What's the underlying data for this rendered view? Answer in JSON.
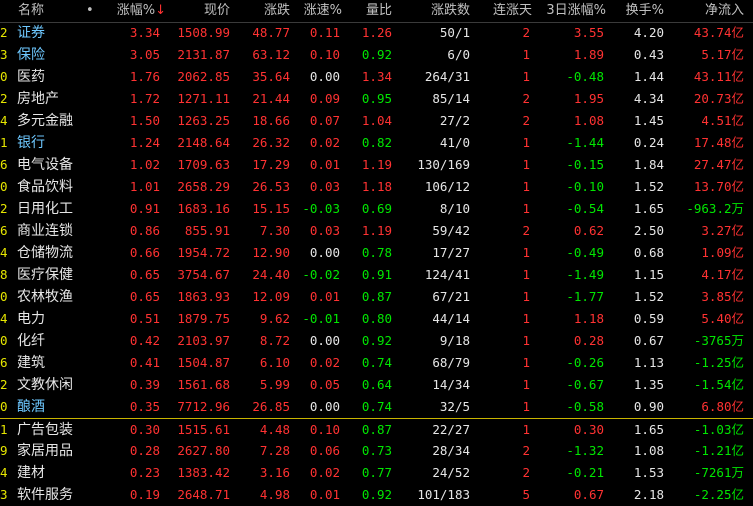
{
  "header": {
    "name": "名称",
    "dot": "•",
    "change_pct": "涨幅%",
    "sort_arrow": "↓",
    "price": "现价",
    "change": "涨跌",
    "speed": "涨速%",
    "volume_ratio": "量比",
    "up_down_count": "涨跌数",
    "consecutive_up_days": "连涨天",
    "three_day_change": "3日涨幅%",
    "turnover": "换手%",
    "net_inflow": "净流入"
  },
  "rows": [
    {
      "idx": "2",
      "name": "证券",
      "highlight": true,
      "chg": "3.34",
      "price": "1508.99",
      "diff": "48.77",
      "speed": "0.11",
      "speed_dir": "up",
      "ratio": "1.26",
      "ratio_dir": "up",
      "ud": "50/1",
      "days": "2",
      "days_dir": "up",
      "chg3": "3.55",
      "chg3_dir": "up",
      "turn": "4.20",
      "flow": "43.74亿",
      "flow_dir": "up"
    },
    {
      "idx": "3",
      "name": "保险",
      "highlight": true,
      "chg": "3.05",
      "price": "2131.87",
      "diff": "63.12",
      "speed": "0.10",
      "speed_dir": "up",
      "ratio": "0.92",
      "ratio_dir": "down",
      "ud": "6/0",
      "days": "1",
      "days_dir": "up",
      "chg3": "1.89",
      "chg3_dir": "up",
      "turn": "0.43",
      "flow": "5.17亿",
      "flow_dir": "up"
    },
    {
      "idx": "0",
      "name": "医药",
      "highlight": false,
      "chg": "1.76",
      "price": "2062.85",
      "diff": "35.64",
      "speed": "0.00",
      "speed_dir": "flat",
      "ratio": "1.34",
      "ratio_dir": "up",
      "ud": "264/31",
      "days": "1",
      "days_dir": "up",
      "chg3": "-0.48",
      "chg3_dir": "down",
      "turn": "1.44",
      "flow": "43.11亿",
      "flow_dir": "up"
    },
    {
      "idx": "2",
      "name": "房地产",
      "highlight": false,
      "chg": "1.72",
      "price": "1271.11",
      "diff": "21.44",
      "speed": "0.09",
      "speed_dir": "up",
      "ratio": "0.95",
      "ratio_dir": "down",
      "ud": "85/14",
      "days": "2",
      "days_dir": "up",
      "chg3": "1.95",
      "chg3_dir": "up",
      "turn": "4.34",
      "flow": "20.73亿",
      "flow_dir": "up"
    },
    {
      "idx": "4",
      "name": "多元金融",
      "highlight": false,
      "chg": "1.50",
      "price": "1263.25",
      "diff": "18.66",
      "speed": "0.07",
      "speed_dir": "up",
      "ratio": "1.04",
      "ratio_dir": "up",
      "ud": "27/2",
      "days": "2",
      "days_dir": "up",
      "chg3": "1.08",
      "chg3_dir": "up",
      "turn": "1.45",
      "flow": "4.51亿",
      "flow_dir": "up"
    },
    {
      "idx": "1",
      "name": "银行",
      "highlight": true,
      "chg": "1.24",
      "price": "2148.64",
      "diff": "26.32",
      "speed": "0.02",
      "speed_dir": "up",
      "ratio": "0.82",
      "ratio_dir": "down",
      "ud": "41/0",
      "days": "1",
      "days_dir": "up",
      "chg3": "-1.44",
      "chg3_dir": "down",
      "turn": "0.24",
      "flow": "17.48亿",
      "flow_dir": "up"
    },
    {
      "idx": "6",
      "name": "电气设备",
      "highlight": false,
      "chg": "1.02",
      "price": "1709.63",
      "diff": "17.29",
      "speed": "0.01",
      "speed_dir": "up",
      "ratio": "1.19",
      "ratio_dir": "up",
      "ud": "130/169",
      "days": "1",
      "days_dir": "up",
      "chg3": "-0.15",
      "chg3_dir": "down",
      "turn": "1.84",
      "flow": "27.47亿",
      "flow_dir": "up"
    },
    {
      "idx": "0",
      "name": "食品饮料",
      "highlight": false,
      "chg": "1.01",
      "price": "2658.29",
      "diff": "26.53",
      "speed": "0.03",
      "speed_dir": "up",
      "ratio": "1.18",
      "ratio_dir": "up",
      "ud": "106/12",
      "days": "1",
      "days_dir": "up",
      "chg3": "-0.10",
      "chg3_dir": "down",
      "turn": "1.52",
      "flow": "13.70亿",
      "flow_dir": "up"
    },
    {
      "idx": "2",
      "name": "日用化工",
      "highlight": false,
      "chg": "0.91",
      "price": "1683.16",
      "diff": "15.15",
      "speed": "-0.03",
      "speed_dir": "down",
      "ratio": "0.69",
      "ratio_dir": "down",
      "ud": "8/10",
      "days": "1",
      "days_dir": "up",
      "chg3": "-0.54",
      "chg3_dir": "down",
      "turn": "1.65",
      "flow": "-963.2万",
      "flow_dir": "down"
    },
    {
      "idx": "6",
      "name": "商业连锁",
      "highlight": false,
      "chg": "0.86",
      "price": "855.91",
      "diff": "7.30",
      "speed": "0.03",
      "speed_dir": "up",
      "ratio": "1.19",
      "ratio_dir": "up",
      "ud": "59/42",
      "days": "2",
      "days_dir": "up",
      "chg3": "0.62",
      "chg3_dir": "up",
      "turn": "2.50",
      "flow": "3.27亿",
      "flow_dir": "up"
    },
    {
      "idx": "4",
      "name": "仓储物流",
      "highlight": false,
      "chg": "0.66",
      "price": "1954.72",
      "diff": "12.90",
      "speed": "0.00",
      "speed_dir": "flat",
      "ratio": "0.78",
      "ratio_dir": "down",
      "ud": "17/27",
      "days": "1",
      "days_dir": "up",
      "chg3": "-0.49",
      "chg3_dir": "down",
      "turn": "0.68",
      "flow": "1.09亿",
      "flow_dir": "up"
    },
    {
      "idx": "8",
      "name": "医疗保健",
      "highlight": false,
      "chg": "0.65",
      "price": "3754.67",
      "diff": "24.40",
      "speed": "-0.02",
      "speed_dir": "down",
      "ratio": "0.91",
      "ratio_dir": "down",
      "ud": "124/41",
      "days": "1",
      "days_dir": "up",
      "chg3": "-1.49",
      "chg3_dir": "down",
      "turn": "1.15",
      "flow": "4.17亿",
      "flow_dir": "up"
    },
    {
      "idx": "0",
      "name": "农林牧渔",
      "highlight": false,
      "chg": "0.65",
      "price": "1863.93",
      "diff": "12.09",
      "speed": "0.01",
      "speed_dir": "up",
      "ratio": "0.87",
      "ratio_dir": "down",
      "ud": "67/21",
      "days": "1",
      "days_dir": "up",
      "chg3": "-1.77",
      "chg3_dir": "down",
      "turn": "1.52",
      "flow": "3.85亿",
      "flow_dir": "up"
    },
    {
      "idx": "4",
      "name": "电力",
      "highlight": false,
      "chg": "0.51",
      "price": "1879.75",
      "diff": "9.62",
      "speed": "-0.01",
      "speed_dir": "down",
      "ratio": "0.80",
      "ratio_dir": "down",
      "ud": "44/14",
      "days": "1",
      "days_dir": "up",
      "chg3": "1.18",
      "chg3_dir": "up",
      "turn": "0.59",
      "flow": "5.40亿",
      "flow_dir": "up"
    },
    {
      "idx": "0",
      "name": "化纤",
      "highlight": false,
      "chg": "0.42",
      "price": "2103.97",
      "diff": "8.72",
      "speed": "0.00",
      "speed_dir": "flat",
      "ratio": "0.92",
      "ratio_dir": "down",
      "ud": "9/18",
      "days": "1",
      "days_dir": "up",
      "chg3": "0.28",
      "chg3_dir": "up",
      "turn": "0.67",
      "flow": "-3765万",
      "flow_dir": "down"
    },
    {
      "idx": "6",
      "name": "建筑",
      "highlight": false,
      "chg": "0.41",
      "price": "1504.87",
      "diff": "6.10",
      "speed": "0.02",
      "speed_dir": "up",
      "ratio": "0.74",
      "ratio_dir": "down",
      "ud": "68/79",
      "days": "1",
      "days_dir": "up",
      "chg3": "-0.26",
      "chg3_dir": "down",
      "turn": "1.13",
      "flow": "-1.25亿",
      "flow_dir": "down"
    },
    {
      "idx": "2",
      "name": "文教休闲",
      "highlight": false,
      "chg": "0.39",
      "price": "1561.68",
      "diff": "5.99",
      "speed": "0.05",
      "speed_dir": "up",
      "ratio": "0.64",
      "ratio_dir": "down",
      "ud": "14/34",
      "days": "1",
      "days_dir": "up",
      "chg3": "-0.67",
      "chg3_dir": "down",
      "turn": "1.35",
      "flow": "-1.54亿",
      "flow_dir": "down"
    },
    {
      "idx": "0",
      "name": "酿酒",
      "highlight": true,
      "chg": "0.35",
      "price": "7712.96",
      "diff": "26.85",
      "speed": "0.00",
      "speed_dir": "flat",
      "ratio": "0.74",
      "ratio_dir": "down",
      "ud": "32/5",
      "days": "1",
      "days_dir": "up",
      "chg3": "-0.58",
      "chg3_dir": "down",
      "turn": "0.90",
      "flow": "6.80亿",
      "flow_dir": "up"
    },
    {
      "idx": "1",
      "name": "广告包装",
      "highlight": false,
      "chg": "0.30",
      "price": "1515.61",
      "diff": "4.48",
      "speed": "0.10",
      "speed_dir": "up",
      "ratio": "0.87",
      "ratio_dir": "down",
      "ud": "22/27",
      "days": "1",
      "days_dir": "up",
      "chg3": "0.30",
      "chg3_dir": "up",
      "turn": "1.65",
      "flow": "-1.03亿",
      "flow_dir": "down",
      "divider": true
    },
    {
      "idx": "9",
      "name": "家居用品",
      "highlight": false,
      "chg": "0.28",
      "price": "2627.80",
      "diff": "7.28",
      "speed": "0.06",
      "speed_dir": "up",
      "ratio": "0.73",
      "ratio_dir": "down",
      "ud": "28/34",
      "days": "2",
      "days_dir": "up",
      "chg3": "-1.32",
      "chg3_dir": "down",
      "turn": "1.08",
      "flow": "-1.21亿",
      "flow_dir": "down"
    },
    {
      "idx": "4",
      "name": "建材",
      "highlight": false,
      "chg": "0.23",
      "price": "1383.42",
      "diff": "3.16",
      "speed": "0.02",
      "speed_dir": "up",
      "ratio": "0.77",
      "ratio_dir": "down",
      "ud": "24/52",
      "days": "2",
      "days_dir": "up",
      "chg3": "-0.21",
      "chg3_dir": "down",
      "turn": "1.53",
      "flow": "-7261万",
      "flow_dir": "down"
    },
    {
      "idx": "3",
      "name": "软件服务",
      "highlight": false,
      "chg": "0.19",
      "price": "2648.71",
      "diff": "4.98",
      "speed": "0.01",
      "speed_dir": "up",
      "ratio": "0.92",
      "ratio_dir": "down",
      "ud": "101/183",
      "days": "5",
      "days_dir": "up",
      "chg3": "0.67",
      "chg3_dir": "up",
      "turn": "2.18",
      "flow": "-2.25亿",
      "flow_dir": "down"
    }
  ],
  "colors": {
    "up": "#ff3232",
    "down": "#00e600",
    "flat": "#e6e6e6",
    "text": "#c0c0c0",
    "name": "#e6e6e6",
    "name_highlight": "#6ec8ff",
    "index": "#e6e600",
    "divider": "#c8b400",
    "background": "#000000"
  }
}
